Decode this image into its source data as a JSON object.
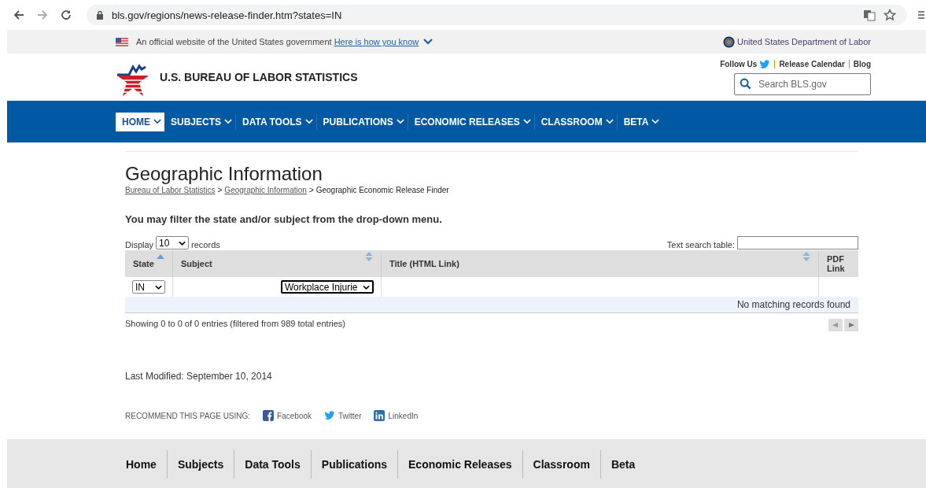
{
  "browser": {
    "url": "bls.gov/regions/news-release-finder.htm?states=IN"
  },
  "gov_banner": {
    "text": "An official website of the United States government",
    "link": "Here is how you know",
    "agency": "United States Department of Labor"
  },
  "header": {
    "title": "U.S. BUREAU OF LABOR STATISTICS",
    "follow": "Follow Us",
    "links": [
      "Release Calendar",
      "Blog"
    ],
    "search_placeholder": "Search BLS.gov"
  },
  "nav": [
    {
      "label": "HOME",
      "selected": true
    },
    {
      "label": "SUBJECTS",
      "selected": false
    },
    {
      "label": "DATA TOOLS",
      "selected": false
    },
    {
      "label": "PUBLICATIONS",
      "selected": false
    },
    {
      "label": "ECONOMIC RELEASES",
      "selected": false
    },
    {
      "label": "CLASSROOM",
      "selected": false
    },
    {
      "label": "BETA",
      "selected": false
    }
  ],
  "page": {
    "title": "Geographic Information",
    "breadcrumb_separator": ">",
    "breadcrumbs": [
      {
        "label": "Bureau of Labor Statistics",
        "link": true
      },
      {
        "label": "Geographic Information",
        "link": true
      },
      {
        "label": "Geographic Economic Release Finder",
        "link": false
      }
    ],
    "instruction": "You may filter the state and/or subject from the drop-down menu.",
    "display_label": "Display",
    "page_length": "10",
    "records_label": "records",
    "search_label": "Text search table:"
  },
  "table": {
    "columns": [
      {
        "label": "State",
        "sortable": true,
        "sorted": true
      },
      {
        "label": "Subject",
        "sortable": true,
        "sorted": false
      },
      {
        "label": "Title (HTML Link)",
        "sortable": true,
        "sorted": false
      },
      {
        "label": "PDF Link",
        "sortable": false
      }
    ],
    "filters": [
      "IN",
      "Workplace Injurie"
    ],
    "empty_message": "No matching records found",
    "info": "Showing 0 to 0 of 0 entries (filtered from 989 total entries)"
  },
  "last_modified": "Last Modified: September 10, 2014",
  "share": {
    "label": "RECOMMEND THIS PAGE USING:",
    "links": [
      {
        "label": "Facebook",
        "kind": "facebook"
      },
      {
        "label": "Twitter",
        "kind": "twitter"
      },
      {
        "label": "LinkedIn",
        "kind": "linkedin"
      }
    ]
  },
  "footer_nav": [
    "Home",
    "Subjects",
    "Data Tools",
    "Publications",
    "Economic Releases",
    "Classroom",
    "Beta"
  ]
}
